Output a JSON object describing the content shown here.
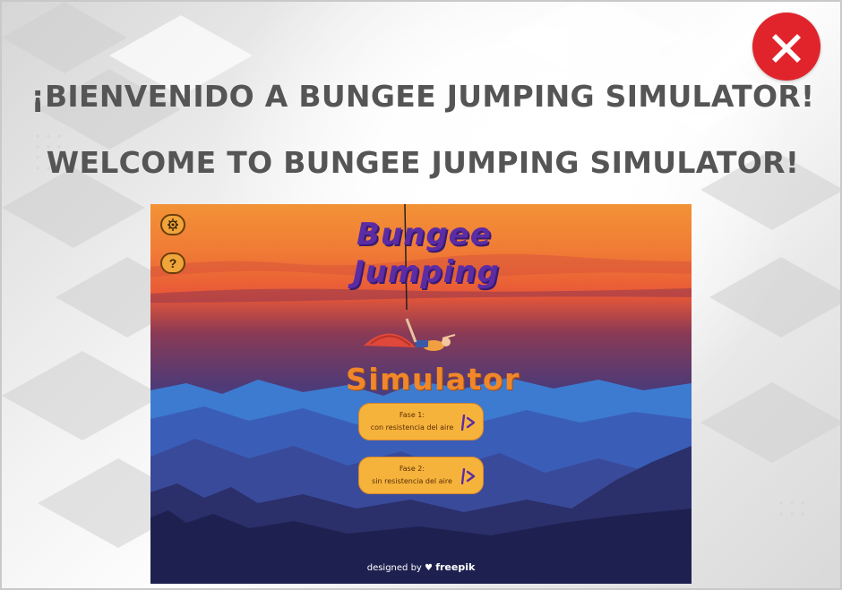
{
  "window": {
    "close_icon": "close-x-icon",
    "accent_color": "#e1242c"
  },
  "headlines": {
    "spanish": "¡BIENVENIDO A BUNGEE JUMPING SIMULATOR!",
    "english": "WELCOME TO BUNGEE JUMPING SIMULATOR!"
  },
  "game": {
    "title_line1": "Bungee",
    "title_line2": "Jumping",
    "title_line3": "Simulator",
    "settings_icon": "gear-icon",
    "help_label": "?",
    "phase_buttons": [
      {
        "line1": "Fase 1:",
        "line2": "con resistencia del aire",
        "icon": "play-arrow-icon"
      },
      {
        "line1": "Fase 2:",
        "line2": "sin resistencia del aire",
        "icon": "play-arrow-icon"
      }
    ],
    "credit_prefix": "designed by",
    "credit_brand": "freepik",
    "colors": {
      "title_purple": "#5b2ca4",
      "title_orange": "#f0872a",
      "button_orange": "#f6b33c"
    }
  }
}
